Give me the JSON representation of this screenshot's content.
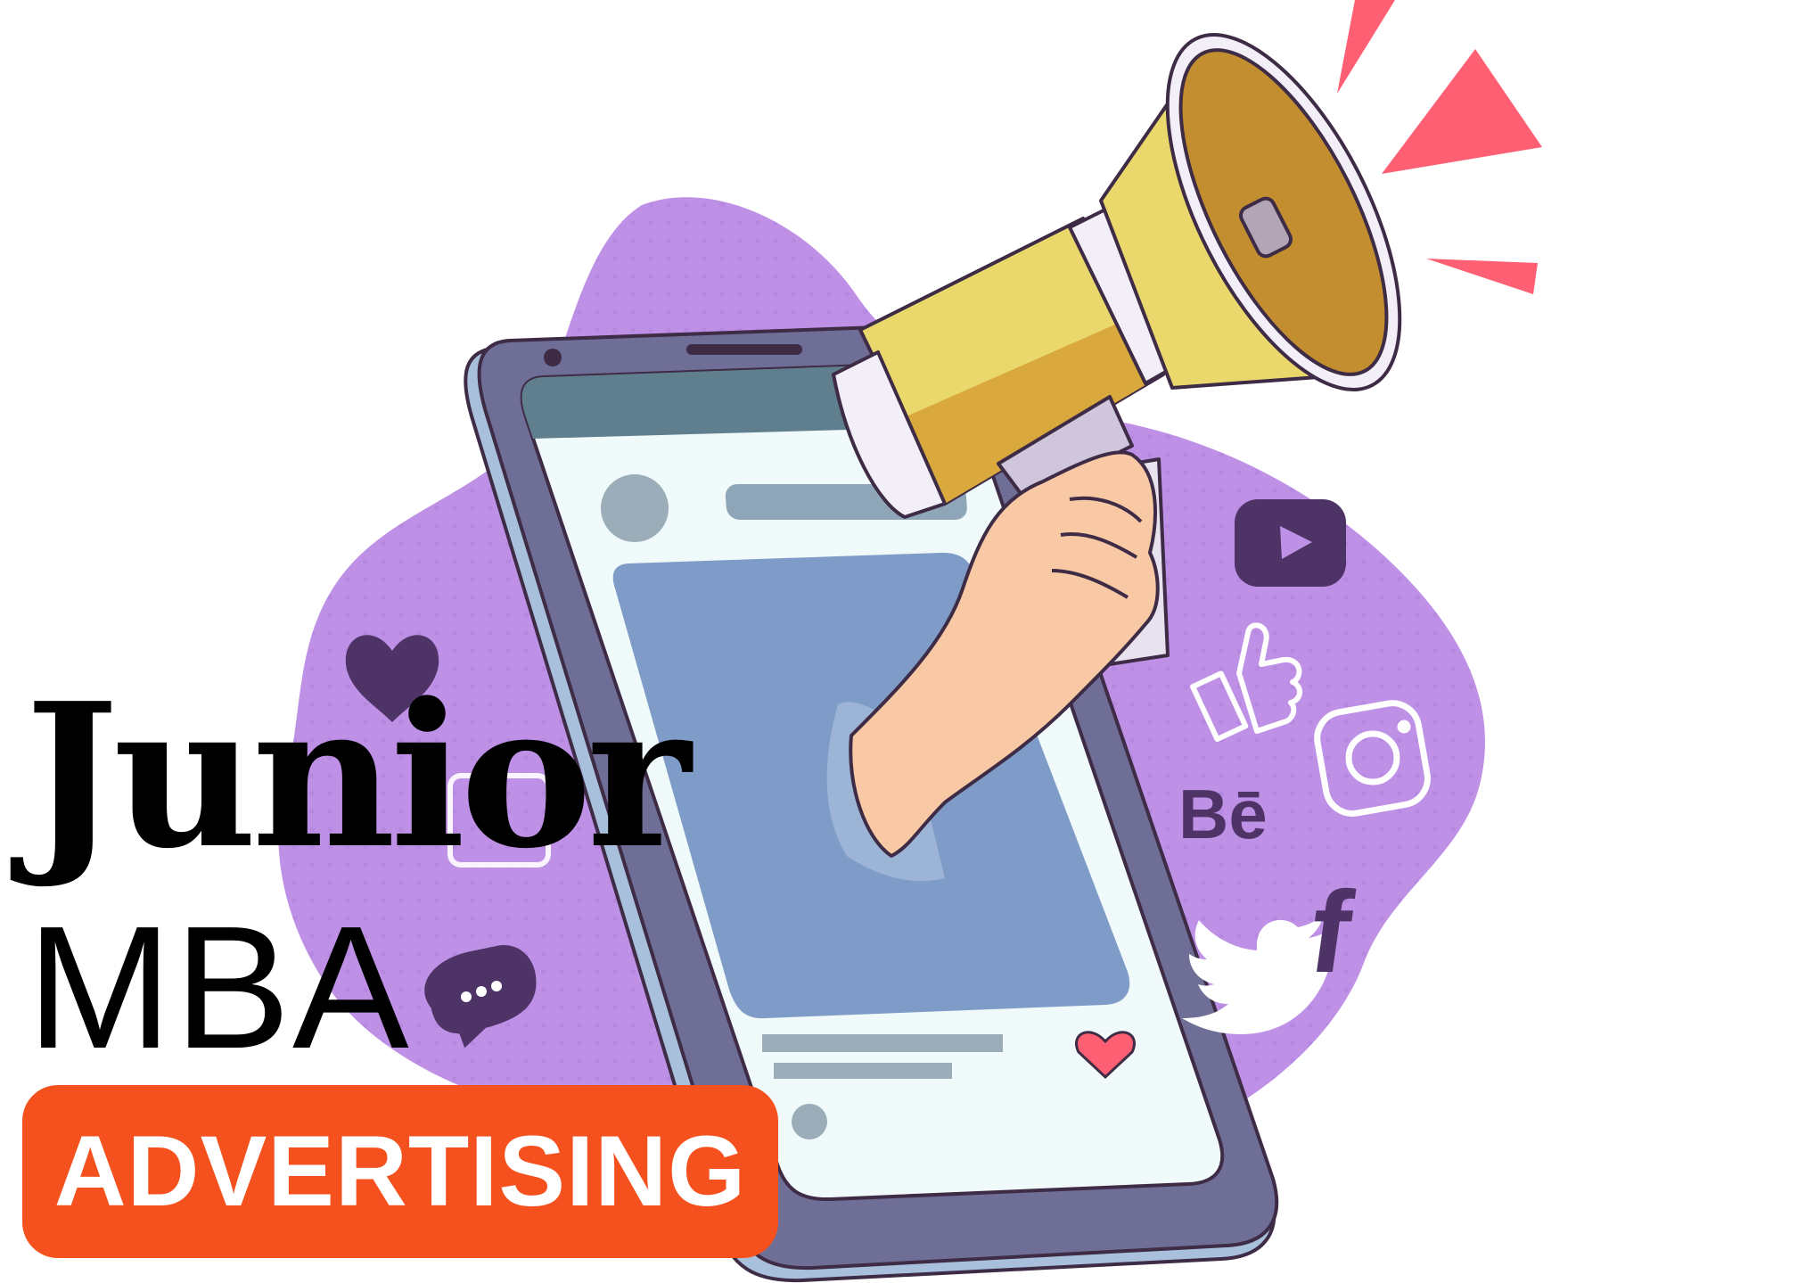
{
  "logo": {
    "line1": "Junior",
    "line2": "MBA"
  },
  "badge": {
    "label": "ADVERTISING",
    "background": "#F4511E",
    "text_color": "#FFFFFF"
  },
  "illustration": {
    "subject": "smartphone with hand holding megaphone",
    "icons": [
      "heart-icon",
      "chat-bubble-icon",
      "youtube-icon",
      "thumbs-up-icon",
      "instagram-icon",
      "behance-icon",
      "twitter-icon",
      "facebook-icon"
    ],
    "behance_text": "Bē",
    "facebook_text": "f",
    "colors": {
      "blob": "#BE90E6",
      "dark_purple": "#4E3466",
      "phone_frame": "#6F6E96",
      "screen": "#F1FAFA",
      "post_image": "#7F9CC8",
      "megaphone": "#EAD86C",
      "megaphone_shade": "#C38E30",
      "skin": "#F8C9A4",
      "accent_pink": "#FF5F73"
    }
  }
}
